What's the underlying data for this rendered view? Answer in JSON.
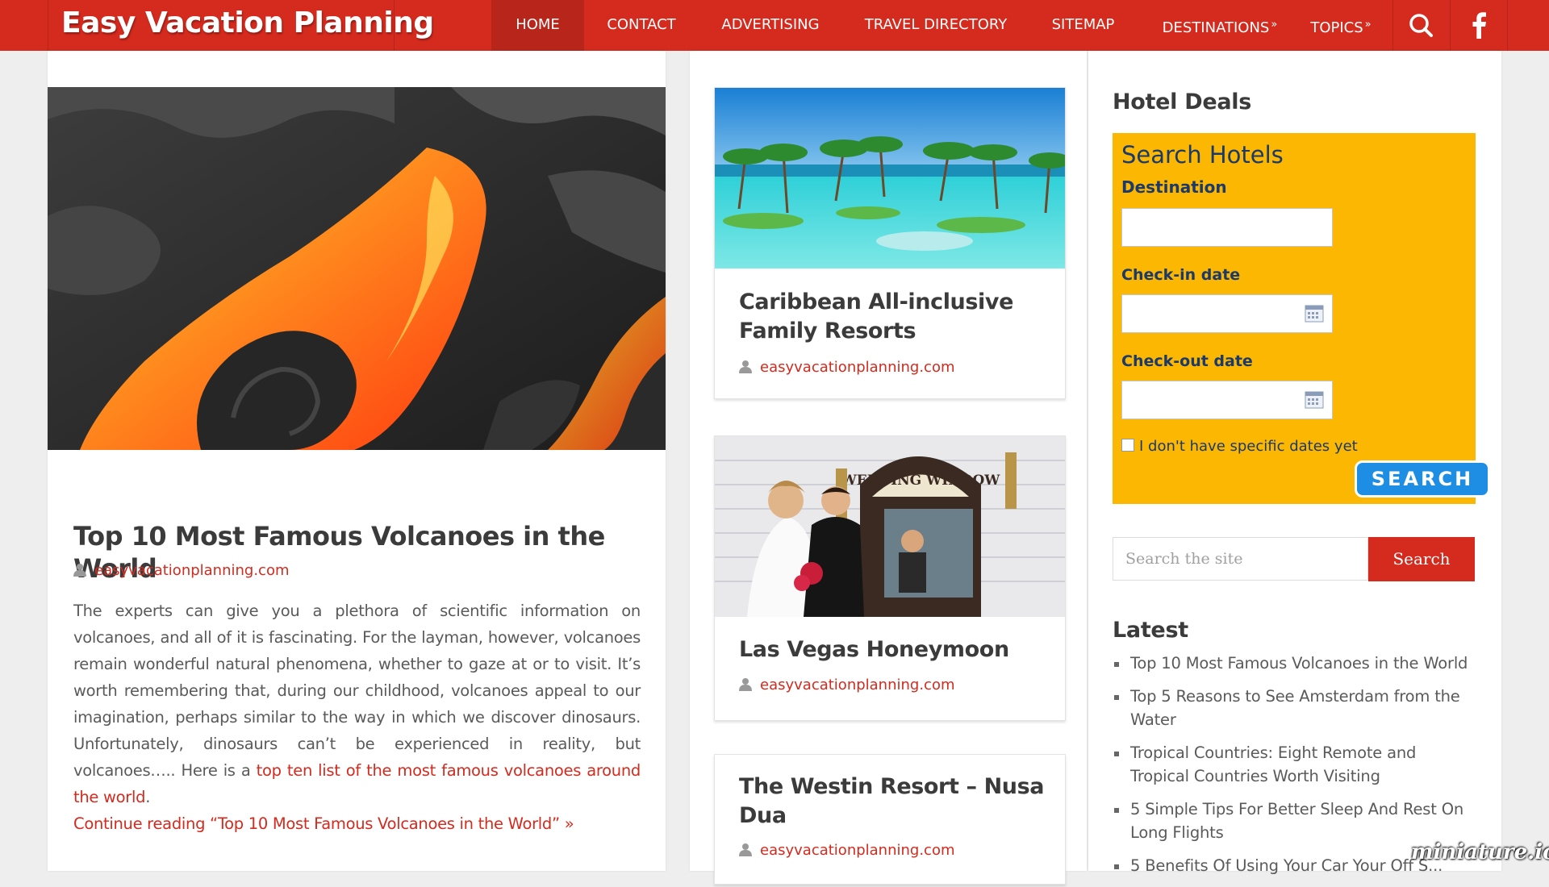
{
  "header": {
    "brand": "Easy Vacation Planning",
    "nav": [
      {
        "label": "HOME",
        "active": true
      },
      {
        "label": "CONTACT"
      },
      {
        "label": "ADVERTISING"
      },
      {
        "label": "TRAVEL DIRECTORY"
      },
      {
        "label": "SITEMAP"
      },
      {
        "label": "DESTINATIONS",
        "suffix": "»"
      },
      {
        "label": "TOPICS",
        "suffix": "»"
      }
    ],
    "search_icon": "search-icon",
    "social_icon": "facebook-icon",
    "color": "#d52a1e"
  },
  "main_post": {
    "title": "Top 10 Most Famous Volcanoes in the World",
    "author": "easyvacationplanning.com",
    "excerpt_text": "The experts can give you a plethora of scientific information on volcanoes, and all of it is fascinating.  For the layman, however, volcanoes remain wonderful natural phenomena, whether to gaze at or to visit.  It’s worth remembering that, during our childhood, volcanoes appeal to our imagination, perhaps similar to the way in which we discover dinosaurs.  Unfortunately, dinosaurs can’t be experienced in reality, but volcanoes….. Here is a ",
    "excerpt_link": "top ten list of the most famous volcanoes around the world",
    "excerpt_end": ".",
    "continue_link": "Continue reading “Top 10 Most Famous Volcanoes in the World” »"
  },
  "cards": [
    {
      "title": "Caribbean All-inclusive Family Resorts",
      "author": "easyvacationplanning.com"
    },
    {
      "title": "Las Vegas Honeymoon",
      "author": "easyvacationplanning.com",
      "image_sign": "WEDDING WINDOW"
    },
    {
      "title": "The Westin Resort – Nusa Dua",
      "author": "easyvacationplanning.com"
    }
  ],
  "sidebar": {
    "hotel_deals_title": "Hotel Deals",
    "hotel_form": {
      "heading": "Search Hotels",
      "destination_label": "Destination",
      "checkin_label": "Check-in date",
      "checkout_label": "Check-out date",
      "no_dates_label": "I don't have specific dates yet",
      "search_button": "SEARCH",
      "box_color": "#fbb701",
      "button_color": "#1e8ee5"
    },
    "site_search": {
      "placeholder": "Search the site",
      "button": "Search"
    },
    "latest_title": "Latest",
    "latest": [
      "Top 10 Most Famous Volcanoes in the World",
      "Top 5 Reasons to See Amsterdam from the Water",
      "Tropical Countries: Eight Remote and Tropical Countries Worth Visiting",
      "5 Simple Tips For Better Sleep And Rest On Long Flights",
      "5 Benefits Of Using Your Car Your Off S..."
    ]
  },
  "watermark": "miniature.io"
}
